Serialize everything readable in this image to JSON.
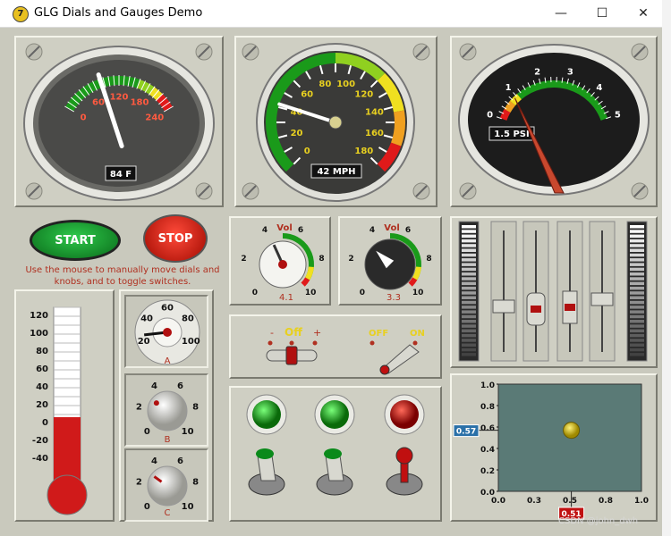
{
  "window": {
    "title": "GLG Dials and Gauges Demo",
    "app_icon_glyph": "7",
    "minimize": "—",
    "maximize": "☐",
    "close": "✕"
  },
  "temp_gauge": {
    "ticks": [
      "0",
      "60",
      "120",
      "180",
      "240"
    ],
    "readout": "84 F",
    "value": 84
  },
  "speed_gauge": {
    "ticks": [
      "0",
      "20",
      "40",
      "60",
      "80",
      "100",
      "120",
      "140",
      "160",
      "180"
    ],
    "readout": "42 MPH",
    "value": 42
  },
  "psi_gauge": {
    "ticks": [
      "0",
      "1",
      "2",
      "3",
      "4",
      "5"
    ],
    "readout": "1.5 PSI",
    "value": 1.5
  },
  "buttons": {
    "start": "START",
    "stop": "STOP",
    "instructions": "Use the mouse to manually move dials and knobs, and to toggle switches."
  },
  "vol_dial_1": {
    "label": "Vol",
    "ticks": [
      "0",
      "2",
      "4",
      "6",
      "8",
      "10"
    ],
    "value_text": "4.1",
    "value": 4.1
  },
  "vol_dial_2": {
    "label": "Vol",
    "ticks": [
      "0",
      "2",
      "4",
      "6",
      "8",
      "10"
    ],
    "value_text": "3.3",
    "value": 3.3
  },
  "thermometer": {
    "ticks": [
      "120",
      "100",
      "80",
      "60",
      "40",
      "20",
      "0",
      "-20",
      "-40"
    ],
    "level": 5
  },
  "knob_a": {
    "ticks": [
      "20",
      "40",
      "60",
      "80",
      "100"
    ],
    "label": "A",
    "value": 25
  },
  "knob_b": {
    "ticks": [
      "0",
      "2",
      "4",
      "6",
      "8",
      "10"
    ],
    "label": "B",
    "value": 3
  },
  "knob_c": {
    "ticks": [
      "0",
      "2",
      "4",
      "6",
      "8",
      "10"
    ],
    "label": "C",
    "value": 3
  },
  "switch_offon": {
    "minus": "-",
    "off": "Off",
    "plus": "+"
  },
  "toggle_switch": {
    "off": "OFF",
    "on": "ON"
  },
  "xy_plot": {
    "y_ticks": [
      "1.0",
      "0.8",
      "0.6",
      "0.4",
      "0.2",
      "0.0"
    ],
    "x_ticks": [
      "0.0",
      "0.3",
      "0.5",
      "0.8",
      "1.0"
    ],
    "y_marker": "0.57",
    "x_marker": "0.51",
    "point_x": 0.51,
    "point_y": 0.57
  },
  "watermark": "CSDN @john_dwh"
}
